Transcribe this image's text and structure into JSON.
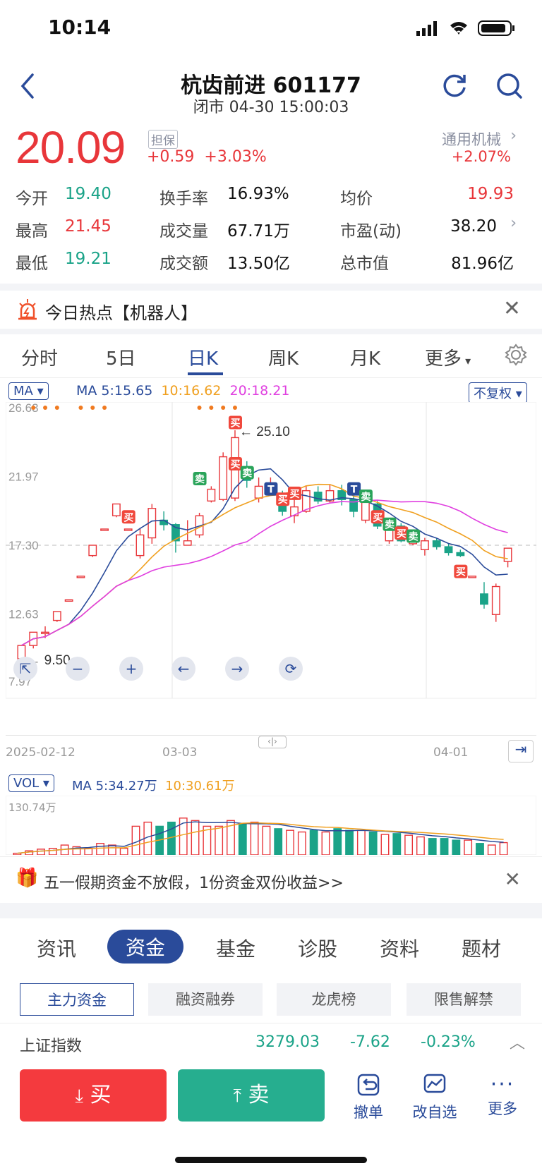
{
  "status": {
    "time": "10:14"
  },
  "header": {
    "title": "杭齿前进 601177",
    "subtitle": "闭市 04-30 15:00:03"
  },
  "quote": {
    "price": "20.09",
    "badge": "担保",
    "change": "+0.59",
    "change_pct": "+3.03%",
    "sector": "通用机械",
    "sector_chg": "+2.07%",
    "stats": [
      {
        "label": "今开",
        "value": "19.40"
      },
      {
        "label": "换手率",
        "value": "16.93%"
      },
      {
        "label": "均价",
        "value": "19.93"
      },
      {
        "label": "最高",
        "value": "21.45"
      },
      {
        "label": "成交量",
        "value": "67.71万"
      },
      {
        "label": "市盈(动)",
        "value": "38.20"
      },
      {
        "label": "最低",
        "value": "19.21"
      },
      {
        "label": "成交额",
        "value": "13.50亿"
      },
      {
        "label": "总市值",
        "value": "81.96亿"
      }
    ]
  },
  "hot": {
    "text": "今日热点【机器人】"
  },
  "ktabs": [
    "分时",
    "5日",
    "日K",
    "周K",
    "月K",
    "更多"
  ],
  "chart": {
    "ma_label": "MA",
    "ma_legend": {
      "ma5": "MA 5:15.65",
      "ma10": "10:16.62",
      "ma20": "20:18.21"
    },
    "adjust": "不复权",
    "y_ticks": [
      "26.63",
      "21.97",
      "17.30",
      "12.63",
      "7.97"
    ],
    "x_ticks": [
      "2025-02-12",
      "03-03",
      "04-01"
    ],
    "max_label": "25.10",
    "min_label": "9.50",
    "vol_label": "VOL",
    "vol_legend": {
      "ma5": "MA 5:34.27万",
      "ma10": "10:30.61万"
    },
    "vol_max": "130.74万",
    "marks": {
      "buy": "买",
      "sell": "卖",
      "t": "T"
    }
  },
  "banner": {
    "text": "五一假期资金不放假，1份资金双份收益>>"
  },
  "sections": [
    "资讯",
    "资金",
    "基金",
    "诊股",
    "资料",
    "题材"
  ],
  "chips": [
    "主力资金",
    "融资融券",
    "龙虎榜",
    "限售解禁"
  ],
  "index": {
    "name": "上证指数",
    "value": "3279.03",
    "chg": "-7.62",
    "pct": "-0.23%"
  },
  "actions": {
    "buy": "买",
    "sell": "卖",
    "tools": [
      "撤单",
      "改自选",
      "更多"
    ]
  },
  "colors": {
    "up": "#e8363a",
    "down": "#1aa388",
    "accent": "#2a4b9a",
    "ma5": "#2a4b9a",
    "ma10": "#f0a020",
    "ma20": "#e040e0"
  },
  "chart_data": {
    "type": "candlestick",
    "ylim": [
      7.97,
      26.63
    ],
    "candles": [
      {
        "o": 9.6,
        "c": 10.5,
        "h": 10.5,
        "l": 9.5
      },
      {
        "o": 10.5,
        "c": 11.4,
        "h": 11.4,
        "l": 10.3
      },
      {
        "o": 11.4,
        "c": 11.4,
        "h": 11.8,
        "l": 11.0
      },
      {
        "o": 12.2,
        "c": 12.8,
        "h": 12.8,
        "l": 12.1
      },
      {
        "o": 13.6,
        "c": 13.6,
        "h": 13.6,
        "l": 13.6
      },
      {
        "o": 15.2,
        "c": 15.2,
        "h": 15.2,
        "l": 15.2
      },
      {
        "o": 16.6,
        "c": 17.3,
        "h": 17.3,
        "l": 16.5
      },
      {
        "o": 18.4,
        "c": 18.4,
        "h": 18.4,
        "l": 18.4
      },
      {
        "o": 19.3,
        "c": 20.1,
        "h": 20.1,
        "l": 19.2
      },
      {
        "o": 18.4,
        "c": 18.4,
        "h": 18.4,
        "l": 18.4
      },
      {
        "o": 16.6,
        "c": 18.0,
        "h": 18.4,
        "l": 16.4
      },
      {
        "o": 17.8,
        "c": 19.8,
        "h": 20.1,
        "l": 17.4
      },
      {
        "o": 19.0,
        "c": 18.7,
        "h": 19.6,
        "l": 18.3
      },
      {
        "o": 18.7,
        "c": 17.6,
        "h": 18.8,
        "l": 16.8
      },
      {
        "o": 17.3,
        "c": 17.6,
        "h": 19.0,
        "l": 17.3
      },
      {
        "o": 18.0,
        "c": 19.3,
        "h": 19.5,
        "l": 17.8
      },
      {
        "o": 20.3,
        "c": 21.1,
        "h": 21.3,
        "l": 20.2
      },
      {
        "o": 20.4,
        "c": 23.3,
        "h": 23.6,
        "l": 20.3
      },
      {
        "o": 20.5,
        "c": 24.6,
        "h": 25.1,
        "l": 20.3
      },
      {
        "o": 22.1,
        "c": 21.7,
        "h": 23.0,
        "l": 21.2
      },
      {
        "o": 20.5,
        "c": 21.3,
        "h": 21.9,
        "l": 20.2
      },
      {
        "o": 21.3,
        "c": 21.5,
        "h": 21.9,
        "l": 20.8
      },
      {
        "o": 20.8,
        "c": 19.6,
        "h": 21.0,
        "l": 19.3
      },
      {
        "o": 19.3,
        "c": 19.9,
        "h": 21.0,
        "l": 18.8
      },
      {
        "o": 19.6,
        "c": 21.0,
        "h": 21.3,
        "l": 19.5
      },
      {
        "o": 20.9,
        "c": 20.3,
        "h": 21.3,
        "l": 20.1
      },
      {
        "o": 20.3,
        "c": 21.0,
        "h": 21.4,
        "l": 20.2
      },
      {
        "o": 21.0,
        "c": 20.4,
        "h": 21.4,
        "l": 20.0
      },
      {
        "o": 20.4,
        "c": 19.6,
        "h": 20.8,
        "l": 19.2
      },
      {
        "o": 19.0,
        "c": 20.2,
        "h": 20.4,
        "l": 18.8
      },
      {
        "o": 20.1,
        "c": 18.6,
        "h": 20.3,
        "l": 18.4
      },
      {
        "o": 17.6,
        "c": 18.6,
        "h": 19.0,
        "l": 17.4
      },
      {
        "o": 18.6,
        "c": 17.6,
        "h": 18.8,
        "l": 17.5
      },
      {
        "o": 17.4,
        "c": 17.9,
        "h": 18.2,
        "l": 17.3
      },
      {
        "o": 17.0,
        "c": 17.6,
        "h": 17.8,
        "l": 16.6
      },
      {
        "o": 17.6,
        "c": 17.2,
        "h": 17.8,
        "l": 17.0
      },
      {
        "o": 17.2,
        "c": 16.8,
        "h": 17.4,
        "l": 16.6
      },
      {
        "o": 16.8,
        "c": 16.6,
        "h": 17.0,
        "l": 16.5
      },
      {
        "o": 15.2,
        "c": 15.2,
        "h": 15.2,
        "l": 15.2
      },
      {
        "o": 14.0,
        "c": 13.3,
        "h": 14.8,
        "l": 13.0
      },
      {
        "o": 12.6,
        "c": 14.5,
        "h": 14.7,
        "l": 12.1
      },
      {
        "o": 16.2,
        "c": 17.1,
        "h": 17.1,
        "l": 15.8
      }
    ],
    "volumes": [
      2,
      5,
      7,
      8,
      12,
      10,
      8,
      14,
      12,
      8,
      35,
      40,
      35,
      40,
      45,
      42,
      35,
      35,
      42,
      38,
      40,
      35,
      32,
      30,
      28,
      30,
      28,
      32,
      30,
      30,
      28,
      25,
      26,
      24,
      22,
      20,
      20,
      18,
      18,
      14,
      12,
      15
    ]
  }
}
